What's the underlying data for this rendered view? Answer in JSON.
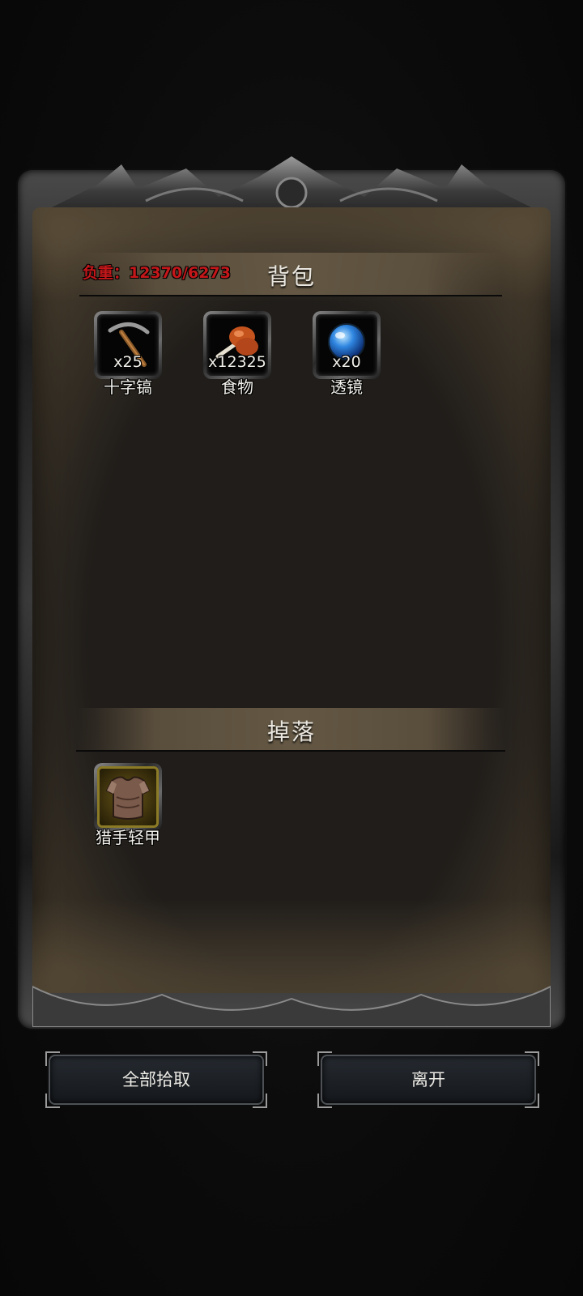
{
  "backpack": {
    "title": "背包",
    "weight_label": "负重：12370/6273",
    "items": [
      {
        "count": "x25",
        "name": "十字镐",
        "icon": "pickaxe-icon"
      },
      {
        "count": "x12325",
        "name": "食物",
        "icon": "meat-drumstick-icon"
      },
      {
        "count": "x20",
        "name": "透镜",
        "icon": "blue-orb-lens-icon"
      }
    ]
  },
  "drops": {
    "title": "掉落",
    "items": [
      {
        "name": "猎手轻甲",
        "icon": "light-armor-icon",
        "rarity_color": "#8b7a26"
      }
    ]
  },
  "buttons": {
    "pick_all": "全部拾取",
    "leave": "离开"
  },
  "colors": {
    "weight_text": "#c4171a",
    "panel_bg": "#201d19"
  }
}
